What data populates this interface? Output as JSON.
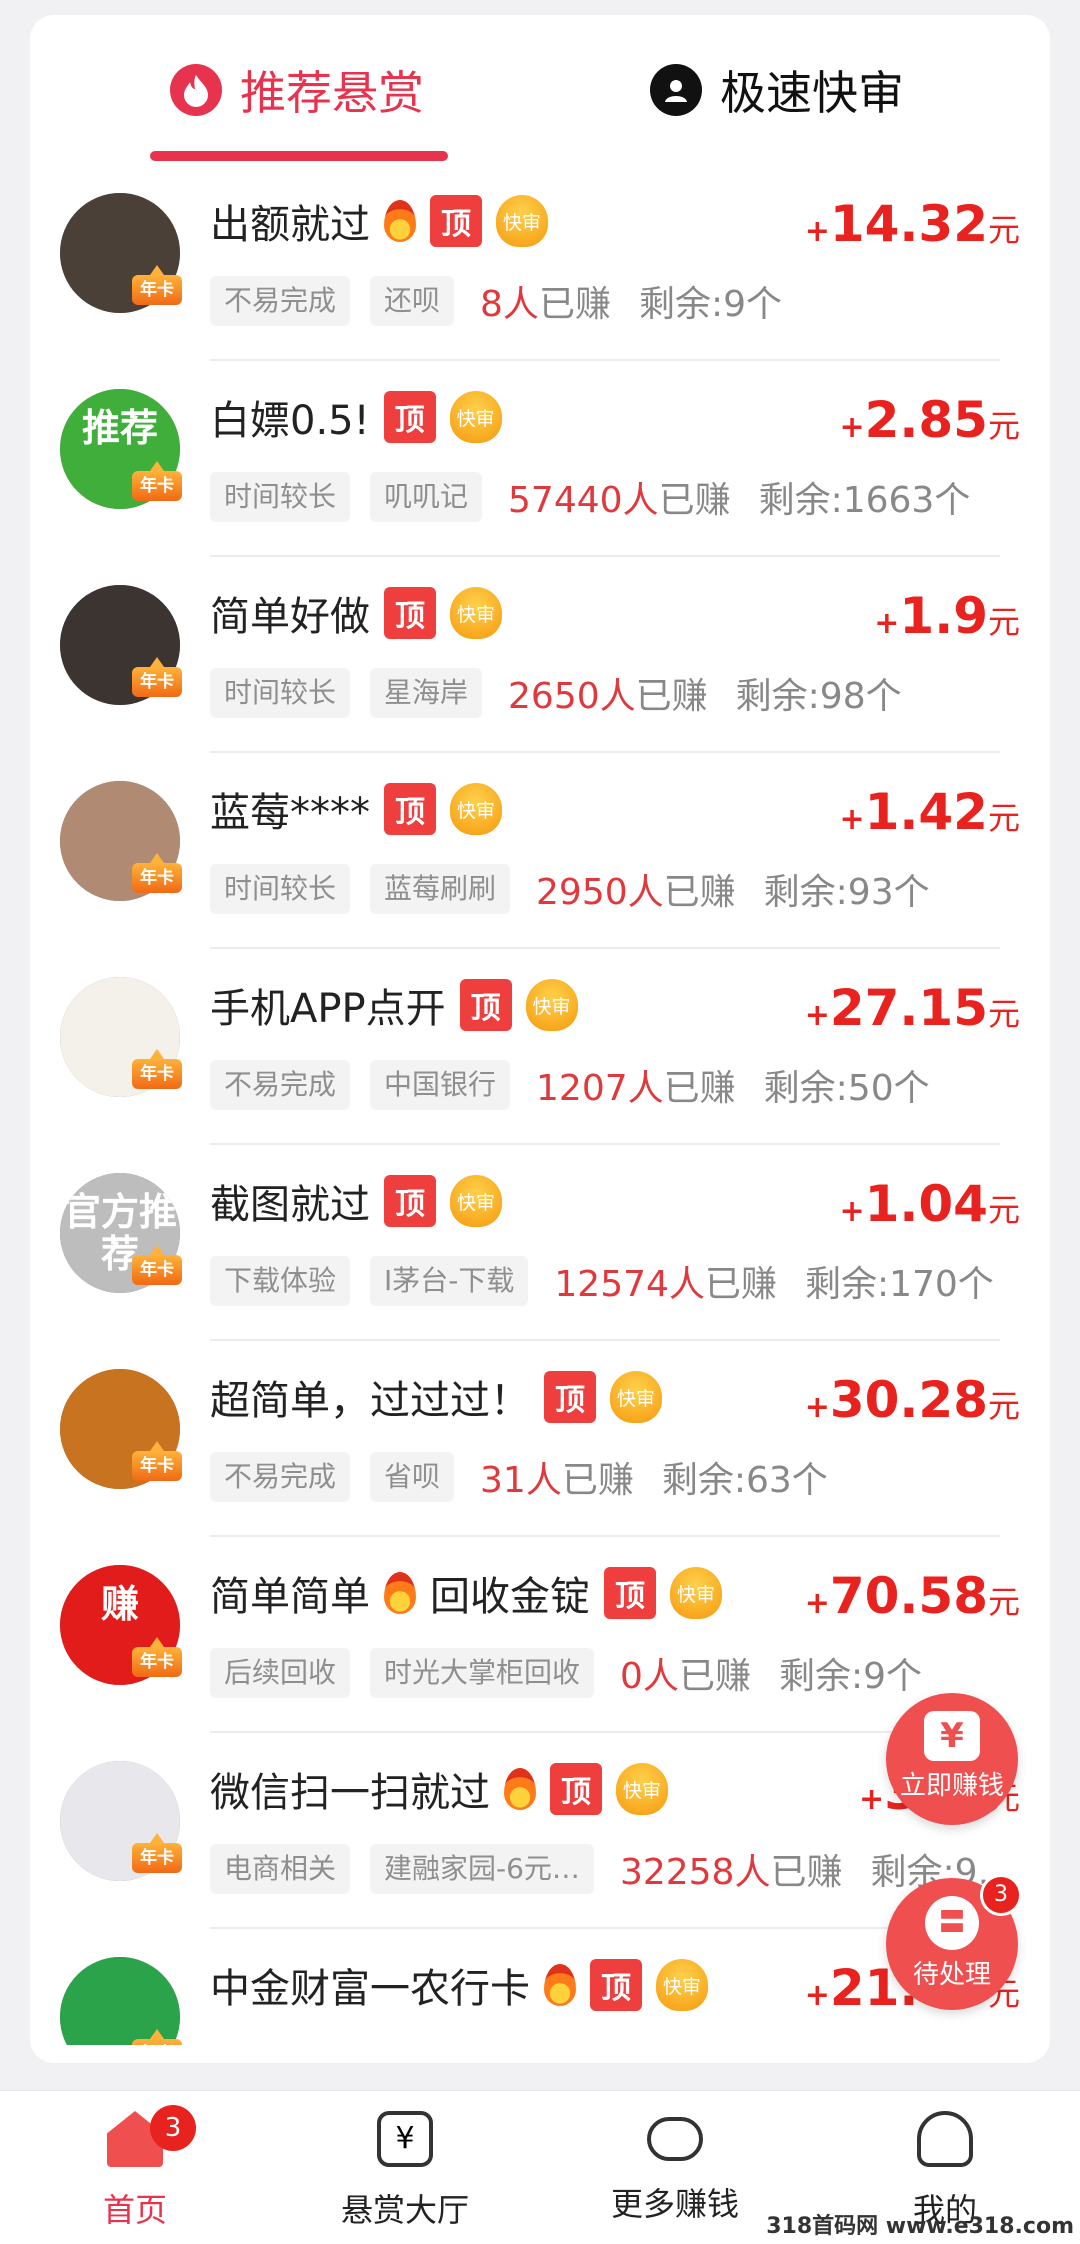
{
  "tabs": {
    "recommend": "推荐悬赏",
    "fast_review": "极速快审"
  },
  "badges": {
    "top": "顶",
    "fast": "快审",
    "annual": "年卡"
  },
  "colors": {
    "accent": "#e8334e",
    "price": "#e8231f"
  },
  "tasks": [
    {
      "title": "出额就过",
      "fire": true,
      "price_num": "14.32",
      "tags": [
        "不易完成",
        "还呗"
      ],
      "count": "8人",
      "earned_label": "已赚",
      "remain": "剩余:9个",
      "avatar_color": "#4a4038",
      "avatar_text": ""
    },
    {
      "title": "白嫖0.5!",
      "fire": false,
      "price_num": "2.85",
      "tags": [
        "时间较长",
        "叽叽记"
      ],
      "count": "57440人",
      "earned_label": "已赚",
      "remain": "剩余:1663个",
      "avatar_color": "#3fae3a",
      "avatar_text": "推荐"
    },
    {
      "title": "简单好做",
      "fire": false,
      "price_num": "1.9",
      "tags": [
        "时间较长",
        "星海岸"
      ],
      "count": "2650人",
      "earned_label": "已赚",
      "remain": "剩余:98个",
      "avatar_color": "#3b3431",
      "avatar_text": ""
    },
    {
      "title": "蓝莓****",
      "fire": false,
      "price_num": "1.42",
      "tags": [
        "时间较长",
        "蓝莓刷刷"
      ],
      "count": "2950人",
      "earned_label": "已赚",
      "remain": "剩余:93个",
      "avatar_color": "#b08a72",
      "avatar_text": ""
    },
    {
      "title": "手机APP点开",
      "fire": false,
      "price_num": "27.15",
      "tags": [
        "不易完成",
        "中国银行"
      ],
      "count": "1207人",
      "earned_label": "已赚",
      "remain": "剩余:50个",
      "avatar_color": "#f4f0ea",
      "avatar_text": ""
    },
    {
      "title": "截图就过",
      "fire": false,
      "price_num": "1.04",
      "tags": [
        "下载体验",
        "I茅台-下载"
      ],
      "count": "12574人",
      "earned_label": "已赚",
      "remain": "剩余:170个",
      "avatar_color": "#bdbdbd",
      "avatar_text": "官方推荐"
    },
    {
      "title": "超简单，过过过！",
      "fire": false,
      "price_num": "30.28",
      "tags": [
        "不易完成",
        "省呗"
      ],
      "count": "31人",
      "earned_label": "已赚",
      "remain": "剩余:63个",
      "avatar_color": "#c8731f",
      "avatar_text": ""
    },
    {
      "title": "简单简单",
      "fire": true,
      "title_suffix": "回收金锭",
      "price_num": "70.58",
      "tags": [
        "后续回收",
        "时光大掌柜回收"
      ],
      "count": "0人",
      "earned_label": "已赚",
      "remain": "剩余:9个",
      "avatar_color": "#e21b1b",
      "avatar_text": "赚"
    },
    {
      "title": "微信扫一扫就过",
      "fire": true,
      "price_num": "3.…",
      "tags": [
        "电商相关",
        "建融家园-6元…"
      ],
      "count": "32258人",
      "earned_label": "已赚",
      "remain": "剩余:9…",
      "avatar_color": "#e8e8ec",
      "avatar_text": ""
    },
    {
      "title": "中金财富一农行卡",
      "fire": true,
      "price_num": "21.85",
      "tags": [],
      "count": "",
      "earned_label": "",
      "remain": "",
      "avatar_color": "#2aa34a",
      "avatar_text": ""
    }
  ],
  "price": {
    "plus": "+",
    "unit": "元"
  },
  "fab": {
    "earn_now": "立即赚钱",
    "earn_icon": "¥",
    "pending": "待处理",
    "pending_badge": "3"
  },
  "nav": {
    "home": "首页",
    "home_badge": "3",
    "bounty_hall": "悬赏大厅",
    "more_earn": "更多赚钱",
    "mine": "我的"
  },
  "watermark": "318首码网 www.e318.com"
}
